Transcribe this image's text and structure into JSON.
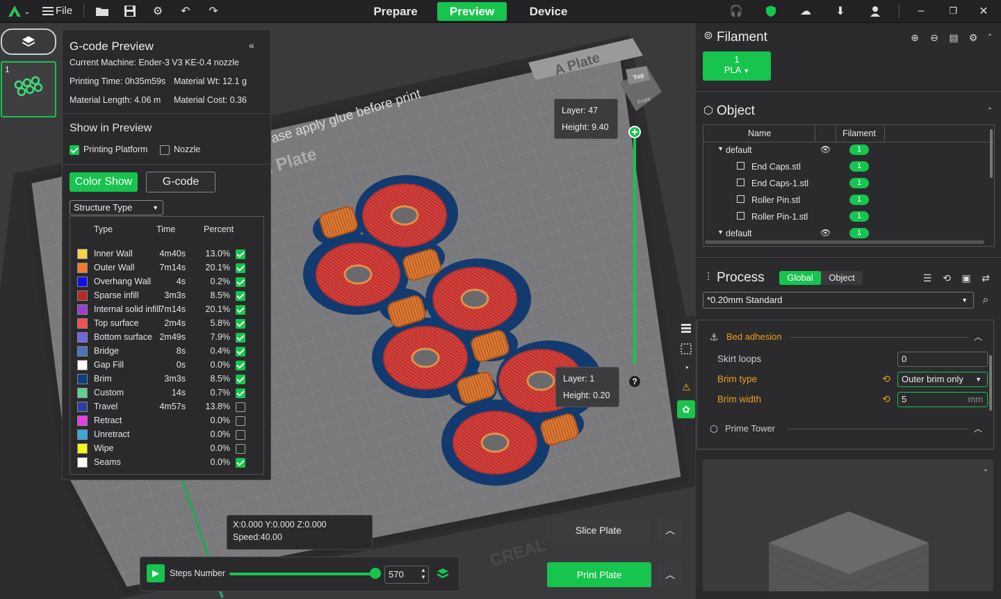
{
  "topbar": {
    "file_label": "File",
    "tabs": [
      {
        "label": "Prepare",
        "active": false
      },
      {
        "label": "Preview",
        "active": true
      },
      {
        "label": "Device",
        "active": false
      }
    ]
  },
  "thumbnail": {
    "plate_number": "1"
  },
  "gcode_panel": {
    "title": "G-code Preview",
    "collapse_icon": "«",
    "machine": "Current Machine: Ender-3 V3 KE-0.4 nozzle",
    "printing_time": "Printing Time: 0h35m59s",
    "material_wt": "Material Wt: 12.1 g",
    "material_length": "Material Length: 4.06 m",
    "material_cost": "Material Cost: 0.36",
    "show_title": "Show in Preview",
    "printing_platform": {
      "label": "Printing Platform",
      "checked": true
    },
    "nozzle": {
      "label": "Nozzle",
      "checked": false
    },
    "color_show_label": "Color Show",
    "gcode_label": "G-code",
    "structure_type": "Structure Type",
    "columns": {
      "type": "Type",
      "time": "Time",
      "percent": "Percent"
    },
    "legend": [
      {
        "name": "Inner Wall",
        "time": "4m40s",
        "percent": "13.0%",
        "color": "#f5d44a",
        "checked": true
      },
      {
        "name": "Outer Wall",
        "time": "7m14s",
        "percent": "20.1%",
        "color": "#f77b2e",
        "checked": true
      },
      {
        "name": "Overhang Wall",
        "time": "4s",
        "percent": "0.2%",
        "color": "#1010ee",
        "checked": true
      },
      {
        "name": "Sparse infill",
        "time": "3m3s",
        "percent": "8.5%",
        "color": "#b22a2a",
        "checked": true
      },
      {
        "name": "Internal solid infill",
        "time": "7m14s",
        "percent": "20.1%",
        "color": "#9a3fd0",
        "checked": true
      },
      {
        "name": "Top surface",
        "time": "2m4s",
        "percent": "5.8%",
        "color": "#f05050",
        "checked": true
      },
      {
        "name": "Bottom surface",
        "time": "2m49s",
        "percent": "7.9%",
        "color": "#7066dd",
        "checked": true
      },
      {
        "name": "Bridge",
        "time": "8s",
        "percent": "0.4%",
        "color": "#4f73b6",
        "checked": true
      },
      {
        "name": "Gap Fill",
        "time": "0s",
        "percent": "0.0%",
        "color": "#ffffff",
        "checked": true
      },
      {
        "name": "Brim",
        "time": "3m3s",
        "percent": "8.5%",
        "color": "#0d3f7a",
        "checked": true
      },
      {
        "name": "Custom",
        "time": "14s",
        "percent": "0.7%",
        "color": "#5fd092",
        "checked": true
      },
      {
        "name": "Travel",
        "time": "4m57s",
        "percent": "13.8%",
        "color": "#2c3fa0",
        "checked": false
      },
      {
        "name": "Retract",
        "time": "",
        "percent": "0.0%",
        "color": "#e23ee6",
        "checked": false
      },
      {
        "name": "Unretract",
        "time": "",
        "percent": "0.0%",
        "color": "#3aa7d6",
        "checked": false
      },
      {
        "name": "Wipe",
        "time": "",
        "percent": "0.0%",
        "color": "#f7f51c",
        "checked": false
      },
      {
        "name": "Seams",
        "time": "",
        "percent": "0.0%",
        "color": "#ffffff",
        "checked": true
      }
    ]
  },
  "viewport": {
    "plate_label": "A Plate",
    "glue_text": "please apply glue before print",
    "bed_text": "Creality Smooth PEI Plate",
    "brand_text": "CREAL",
    "cube_top": "Top",
    "cube_front": "Front",
    "layer_top": {
      "layer": "Layer: 47",
      "height": "Height: 9.40"
    },
    "layer_bottom": {
      "layer": "Layer: 1",
      "height": "Height: 0.20"
    },
    "help": "?",
    "coords": "X:0.000  Y:0.000  Z:0.000",
    "speed": "Speed:40.00",
    "steps_label": "Steps Number",
    "steps_value": "570",
    "steps_fraction": 1.0,
    "slice_label": "Slice Plate",
    "print_label": "Print Plate"
  },
  "filament": {
    "title": "Filament",
    "slot_number": "1",
    "slot_type": "PLA"
  },
  "object": {
    "title": "Object",
    "col_name": "Name",
    "col_filament": "Filament",
    "rows": [
      {
        "name": "default",
        "indent": 0,
        "eye": true,
        "filament": "1"
      },
      {
        "name": "End Caps.stl",
        "indent": 1,
        "eye": false,
        "filament": "1"
      },
      {
        "name": "End Caps-1.stl",
        "indent": 1,
        "eye": false,
        "filament": "1"
      },
      {
        "name": "Roller Pin.stl",
        "indent": 1,
        "eye": false,
        "filament": "1"
      },
      {
        "name": "Roller Pin-1.stl",
        "indent": 1,
        "eye": false,
        "filament": "1"
      },
      {
        "name": "default",
        "indent": 0,
        "eye": true,
        "filament": "1"
      }
    ]
  },
  "process": {
    "title": "Process",
    "tab_global": "Global",
    "tab_object": "Object",
    "preset": "*0.20mm Standard",
    "bed_adhesion": "Bed adhesion",
    "skirt_loops_label": "Skirt loops",
    "skirt_loops_value": "0",
    "brim_type_label": "Brim type",
    "brim_type_value": "Outer brim only",
    "brim_width_label": "Brim width",
    "brim_width_value": "5",
    "brim_width_unit": "mm",
    "prime_tower": "Prime Tower"
  }
}
